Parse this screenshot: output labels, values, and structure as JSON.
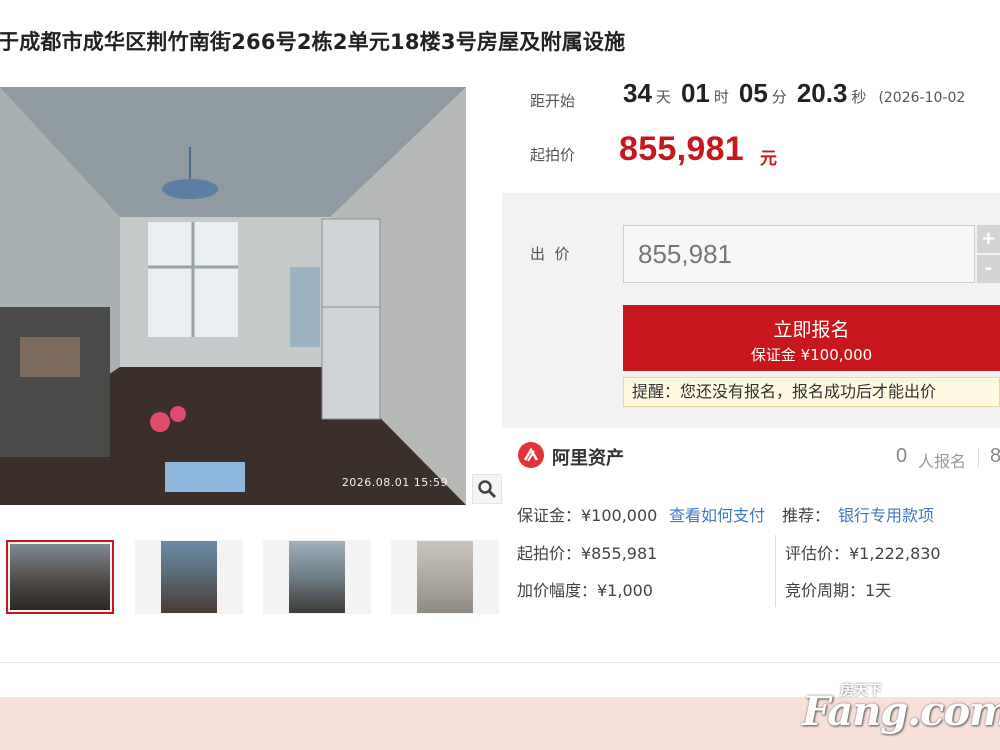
{
  "title": "于成都市成华区荆竹南街266号2栋2单元18楼3号房屋及附属设施",
  "photo": {
    "timestamp": "2026.08.01 15:59",
    "zoom_icon": "magnifier-icon"
  },
  "thumbnails": [
    {
      "label": "thumb-1",
      "active": true
    },
    {
      "label": "thumb-2",
      "active": false
    },
    {
      "label": "thumb-3",
      "active": false
    },
    {
      "label": "thumb-4",
      "active": false
    }
  ],
  "countdown": {
    "label": "距开始",
    "days": "34",
    "days_unit": "天",
    "hours": "01",
    "hours_unit": "时",
    "minutes": "05",
    "minutes_unit": "分",
    "seconds": "20.3",
    "seconds_unit": "秒",
    "date": "(2026-10-02"
  },
  "start_price": {
    "label": "起拍价",
    "value": "855,981",
    "unit": "元"
  },
  "bid": {
    "label": "出  价",
    "value": "855,981",
    "increment": "+",
    "decrement": "-",
    "signup_label": "立即报名",
    "deposit_label": "保证金 ¥100,000",
    "notice": "提醒：您还没有报名，报名成功后才能出价"
  },
  "provider": {
    "name": "阿里资产",
    "count": "0",
    "count_label": "人报名",
    "more": "8"
  },
  "details": {
    "deposit": "保证金：¥100,000",
    "how_to_pay": "查看如何支付",
    "recommend_label": "推荐：",
    "recommend_link": "银行专用款项",
    "start_price": "起拍价：¥855,981",
    "appraisal": "评估价：¥1,222,830",
    "increment": "加价幅度：¥1,000",
    "period": "竞价周期：1天"
  },
  "watermark": {
    "main": "Fang.com",
    "cn": "房天下"
  },
  "colors": {
    "accent": "#c8161d",
    "link": "#3f78c4",
    "notice_bg": "#fff9e1",
    "footer_bg": "#f8e0d9"
  }
}
